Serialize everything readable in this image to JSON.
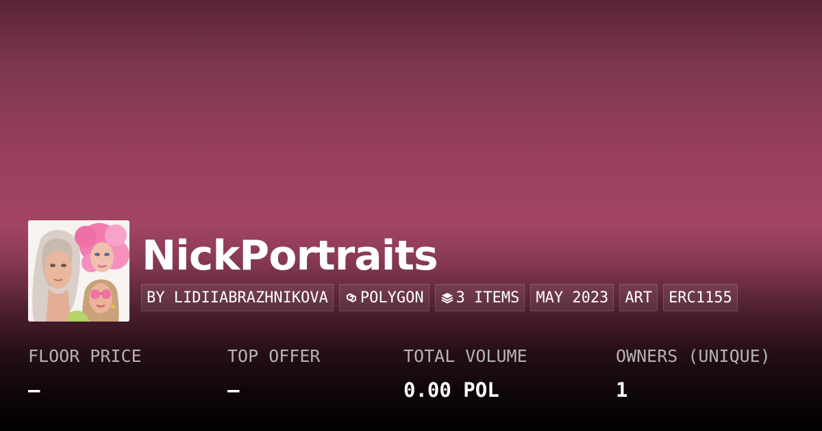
{
  "collection": {
    "name": "NickPortraits",
    "thumbnail_alt": "NickPortraits collection image"
  },
  "tags": [
    {
      "label": "BY LIDIIABRAZHNIKOVA",
      "icon": null
    },
    {
      "label": "POLYGON",
      "icon": "polygon-chain-icon"
    },
    {
      "label": "3 ITEMS",
      "icon": "layers-icon"
    },
    {
      "label": "MAY 2023",
      "icon": null
    },
    {
      "label": "ART",
      "icon": null
    },
    {
      "label": "ERC1155",
      "icon": null
    }
  ],
  "stats": [
    {
      "label": "FLOOR PRICE",
      "value": "–"
    },
    {
      "label": "TOP OFFER",
      "value": "–"
    },
    {
      "label": "TOTAL VOLUME",
      "value": "0.00 POL"
    },
    {
      "label": "OWNERS (UNIQUE)",
      "value": "1"
    }
  ],
  "colors": {
    "background_top": "#5a2438",
    "background_mid": "#a24563",
    "background_bottom": "#030102",
    "label_gray": "#b4b4b4",
    "text": "#ffffff"
  }
}
